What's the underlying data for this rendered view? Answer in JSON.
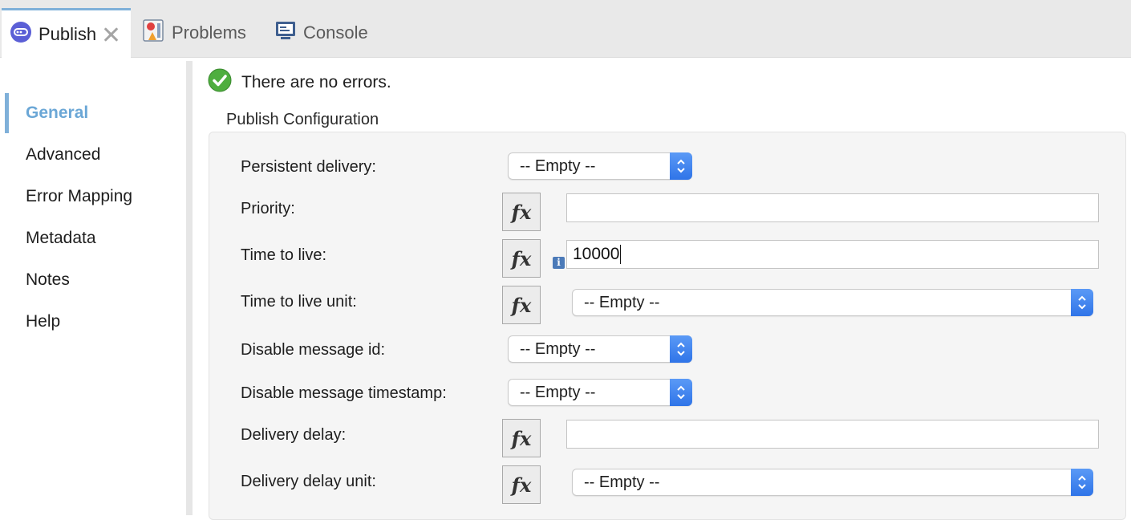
{
  "tabs": [
    {
      "label": "Publish",
      "icon": "publish-icon",
      "active": true
    },
    {
      "label": "Problems",
      "icon": "problems-icon",
      "active": false
    },
    {
      "label": "Console",
      "icon": "console-icon",
      "active": false
    }
  ],
  "sidebar": {
    "items": [
      {
        "label": "General",
        "active": true
      },
      {
        "label": "Advanced"
      },
      {
        "label": "Error Mapping"
      },
      {
        "label": "Metadata"
      },
      {
        "label": "Notes"
      },
      {
        "label": "Help"
      }
    ]
  },
  "status": {
    "text": "There are no errors.",
    "icon": "check-circle-icon"
  },
  "section": {
    "title": "Publish Configuration"
  },
  "fields": {
    "persistent_delivery": {
      "label": "Persistent delivery:",
      "value": "-- Empty --"
    },
    "priority": {
      "label": "Priority:",
      "value": ""
    },
    "time_to_live": {
      "label": "Time to live:",
      "value": "10000"
    },
    "time_to_live_unit": {
      "label": "Time to live unit:",
      "value": "-- Empty --"
    },
    "disable_message_id": {
      "label": "Disable message id:",
      "value": "-- Empty --"
    },
    "disable_message_timestamp": {
      "label": "Disable message timestamp:",
      "value": "-- Empty --"
    },
    "delivery_delay": {
      "label": "Delivery delay:",
      "value": ""
    },
    "delivery_delay_unit": {
      "label": "Delivery delay unit:",
      "value": "-- Empty --"
    }
  },
  "fx_label": "fx",
  "info_label": "i",
  "colors": {
    "accent": "#7fb0d9",
    "select_arrow": "#3a7ff0",
    "success": "#5cb85c"
  }
}
